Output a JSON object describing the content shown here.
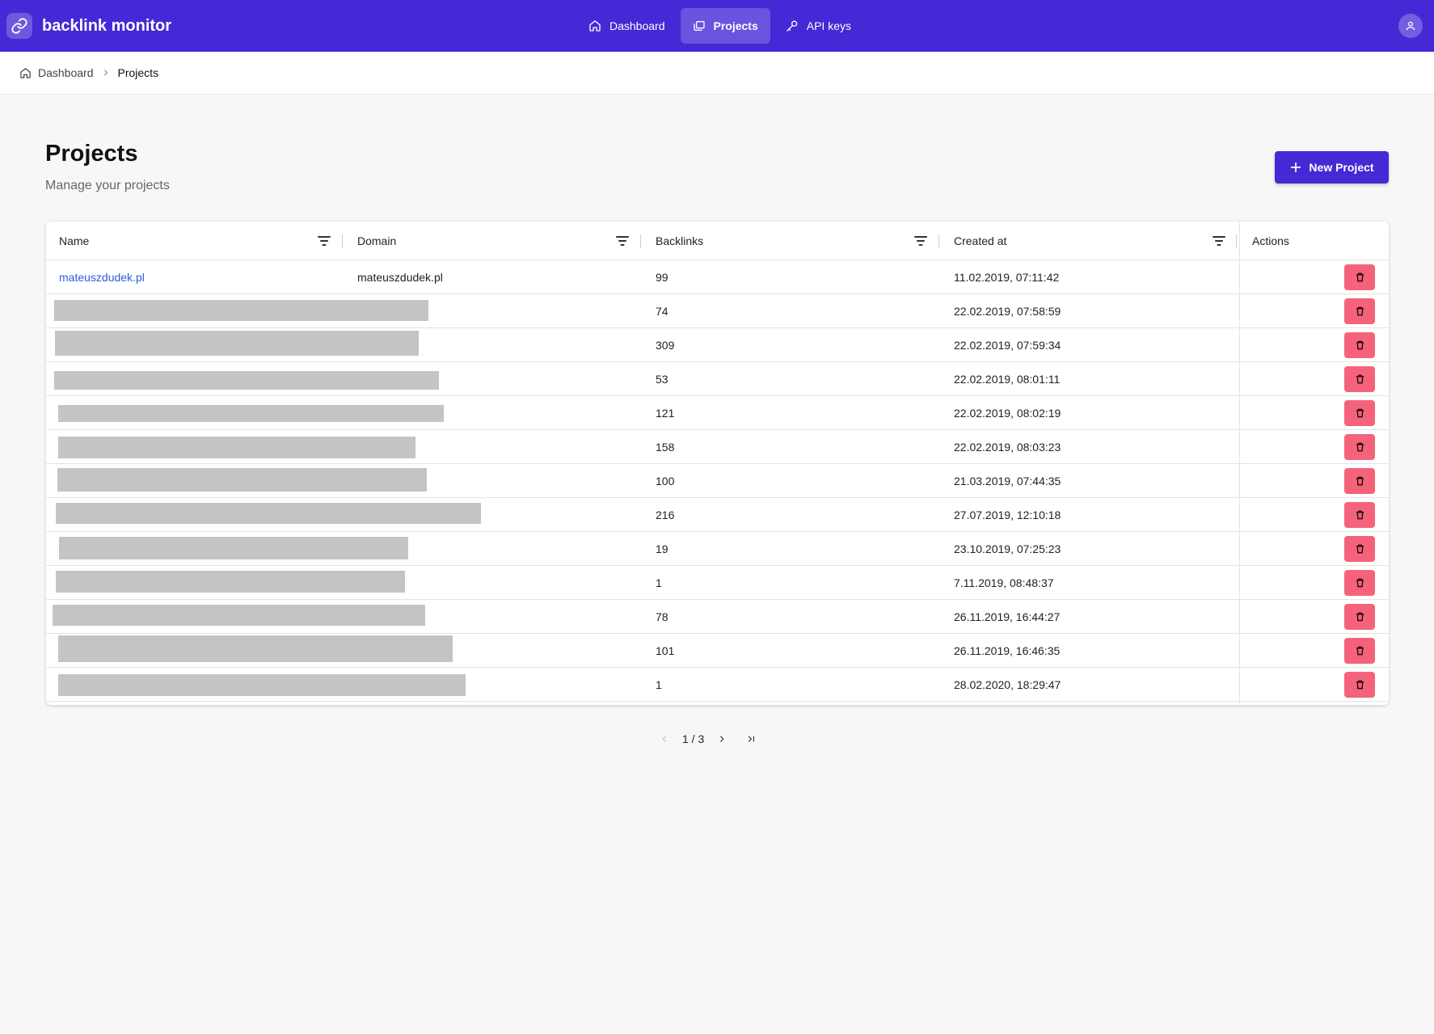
{
  "app": {
    "name": "backlink monitor"
  },
  "nav": {
    "dashboard": "Dashboard",
    "projects": "Projects",
    "api_keys": "API keys"
  },
  "breadcrumb": {
    "home": "Dashboard",
    "current": "Projects"
  },
  "header": {
    "title": "Projects",
    "subtitle": "Manage your projects",
    "new_button": "New Project"
  },
  "table": {
    "columns": [
      "Name",
      "Domain",
      "Backlinks",
      "Created at",
      "Actions"
    ],
    "rows": [
      {
        "name": "mateuszdudek.pl",
        "domain": "mateuszdudek.pl",
        "backlinks": "99",
        "created": "11.02.2019, 07:11:42"
      },
      {
        "name": "",
        "domain": "",
        "backlinks": "74",
        "created": "22.02.2019, 07:58:59"
      },
      {
        "name": "",
        "domain": "",
        "backlinks": "309",
        "created": "22.02.2019, 07:59:34"
      },
      {
        "name": "",
        "domain": "",
        "backlinks": "53",
        "created": "22.02.2019, 08:01:11"
      },
      {
        "name": "",
        "domain": "",
        "backlinks": "121",
        "created": "22.02.2019, 08:02:19"
      },
      {
        "name": "",
        "domain": "",
        "backlinks": "158",
        "created": "22.02.2019, 08:03:23"
      },
      {
        "name": "",
        "domain": "",
        "backlinks": "100",
        "created": "21.03.2019, 07:44:35"
      },
      {
        "name": "",
        "domain": "",
        "backlinks": "216",
        "created": "27.07.2019, 12:10:18"
      },
      {
        "name": "",
        "domain": "",
        "backlinks": "19",
        "created": "23.10.2019, 07:25:23"
      },
      {
        "name": "",
        "domain": "",
        "backlinks": "1",
        "created": "7.11.2019, 08:48:37"
      },
      {
        "name": "",
        "domain": "",
        "backlinks": "78",
        "created": "26.11.2019, 16:44:27"
      },
      {
        "name": "",
        "domain": "",
        "backlinks": "101",
        "created": "26.11.2019, 16:46:35"
      },
      {
        "name": "",
        "domain": "",
        "backlinks": "1",
        "created": "28.02.2020, 18:29:47"
      }
    ]
  },
  "pagination": {
    "text": "1 / 3"
  },
  "colors": {
    "brand": "#4529d6",
    "link": "#2a5fd8",
    "danger": "#f4637a"
  }
}
